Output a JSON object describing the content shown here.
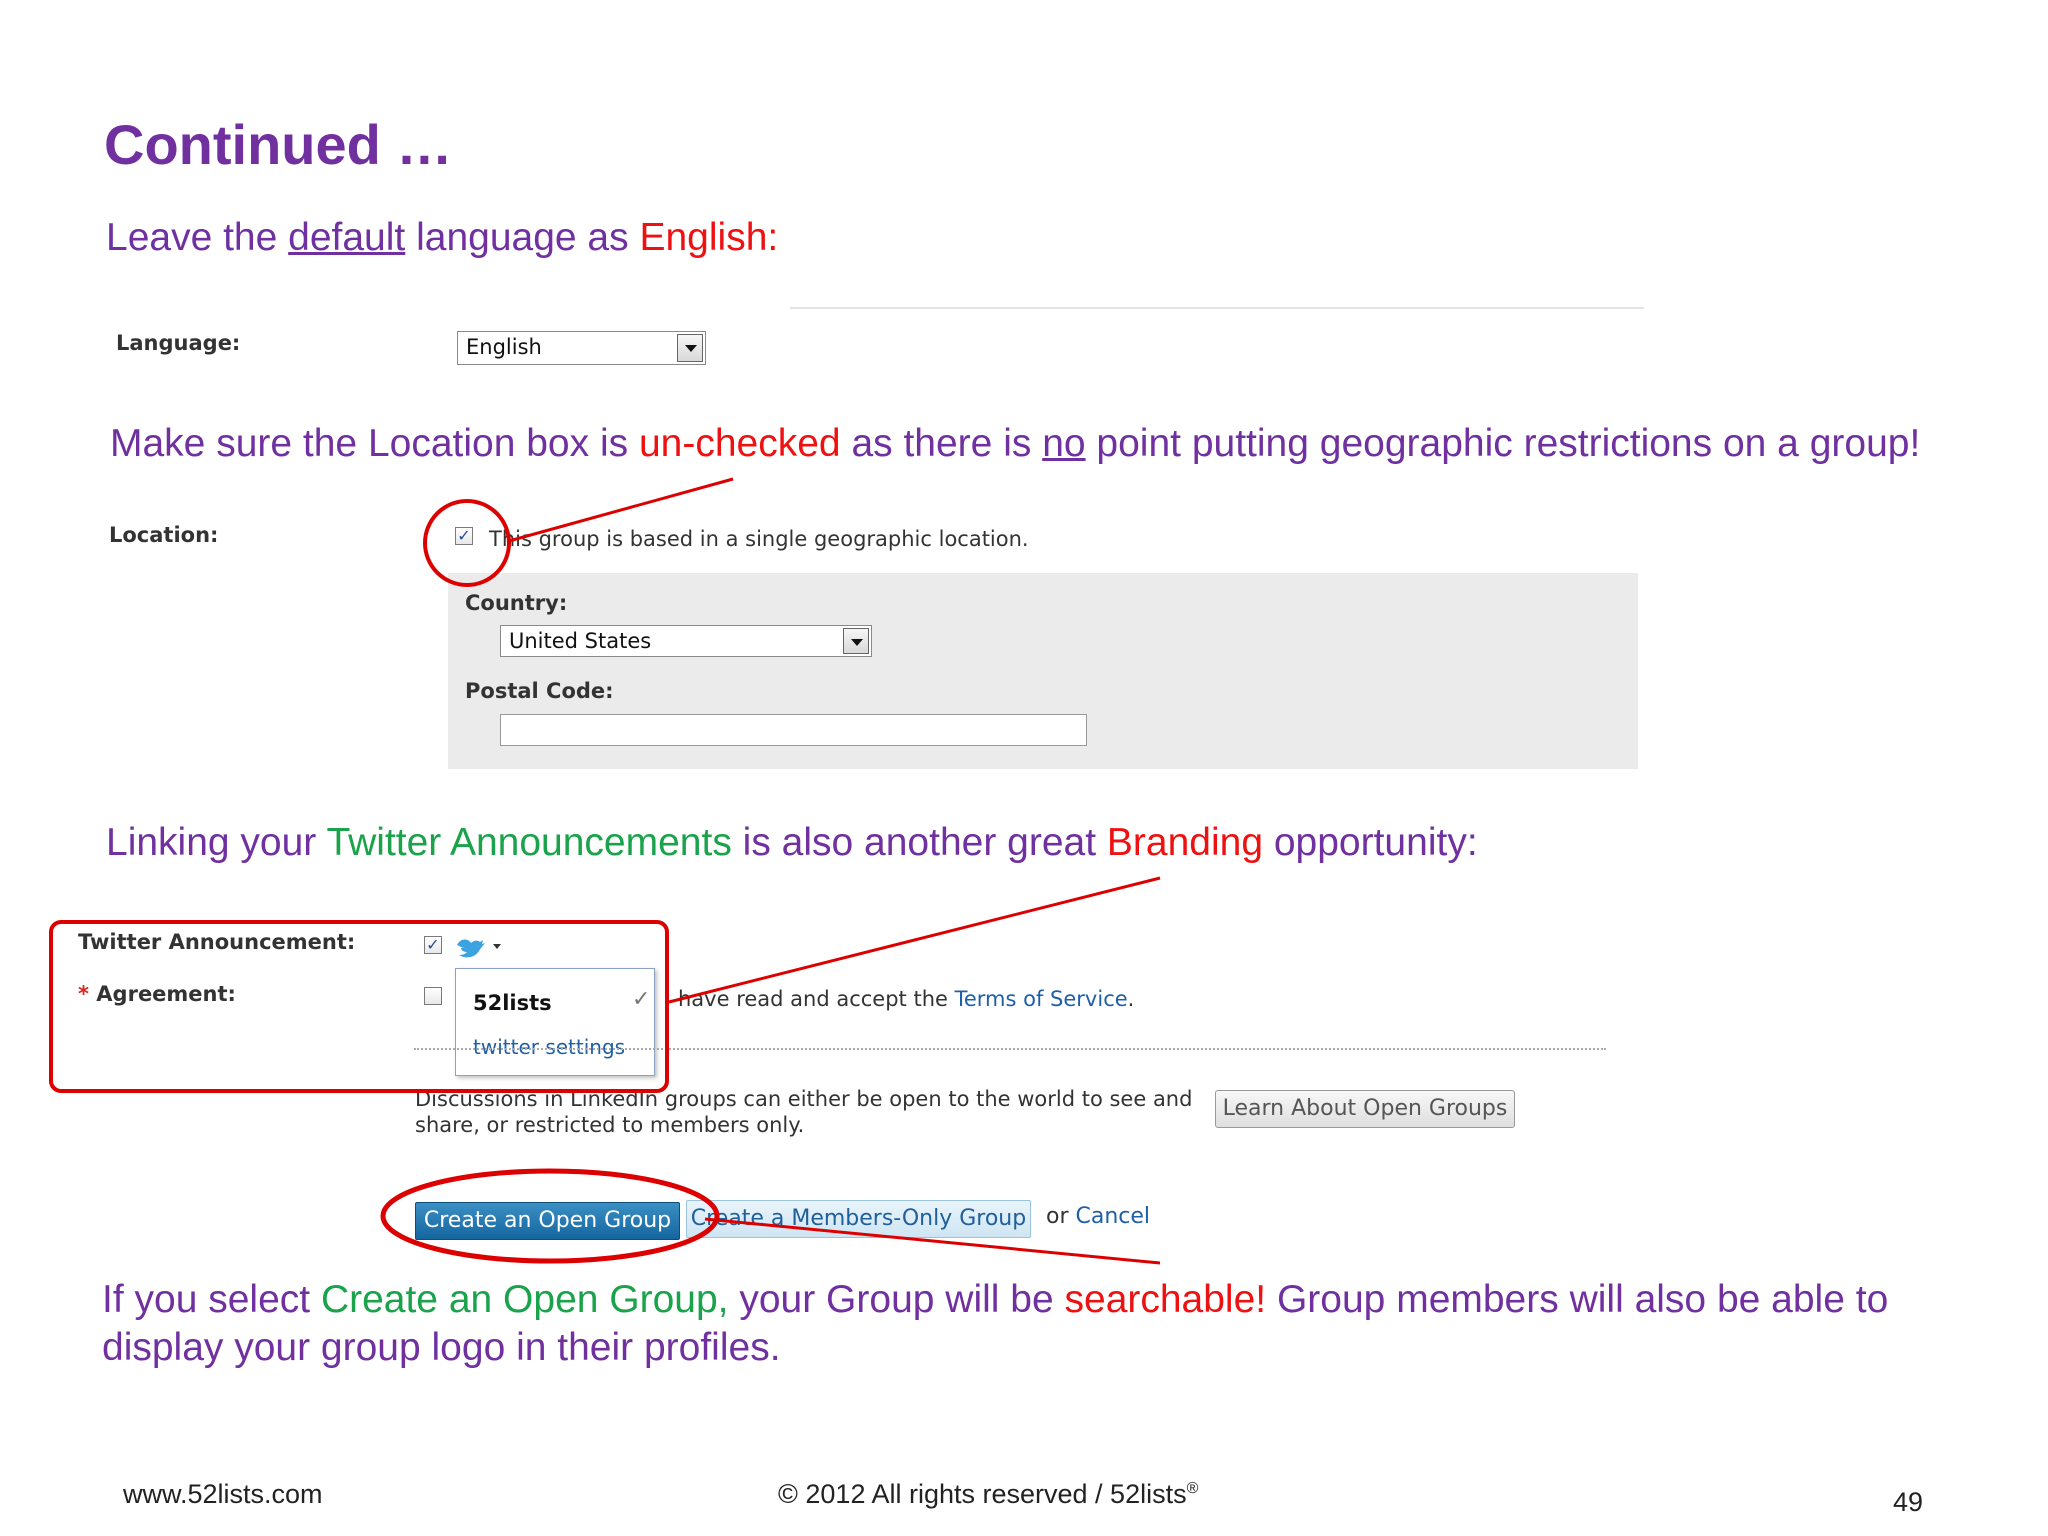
{
  "slide": {
    "title": "Continued …",
    "caption1": {
      "p1": "Leave the ",
      "p2": "default",
      "p3": " language as ",
      "p4": "English:"
    },
    "caption2": {
      "p1": "Make sure the Location box is ",
      "p2": "un-checked",
      "p3": " as there is ",
      "p4": "no",
      "p5": " point putting geographic restrictions on a group!"
    },
    "caption3": {
      "p1": "Linking your ",
      "p2": "Twitter Announcements",
      "p3": " is also another great ",
      "p4": "Branding",
      "p5": " opportunity:"
    },
    "caption4": {
      "p1": "If you select  ",
      "p2": "Create an Open Group,",
      "p3": " your Group will be ",
      "p4": "searchable!",
      "p5": " Group members will also be able to",
      "line2": "display your group logo in their profiles."
    }
  },
  "form": {
    "language_label": "Language:",
    "language_value": "English",
    "location_label": "Location:",
    "location_checked": true,
    "location_text": "This group is based in a single geographic location.",
    "country_label": "Country:",
    "country_value": "United States",
    "postal_label": "Postal Code:",
    "postal_value": "",
    "twitter_label": "Twitter Announcement:",
    "twitter_checked": true,
    "agreement_star": "*",
    "agreement_label": "Agreement:",
    "agreement_checked": false,
    "agreement_text": "have read and accept the ",
    "terms_link": "Terms of Service",
    "terms_period": ".",
    "popup_account": "52lists",
    "popup_check": "✓",
    "popup_settings": "twitter settings",
    "discussion_line1": "Discussions in LinkedIn groups can either be open to the world to see and",
    "discussion_line2": "share, or restricted to members only.",
    "learn_button": "Learn About Open Groups",
    "create_open_button": "Create an Open Group",
    "create_members_button": "Create a Members-Only Group",
    "or_text": "or ",
    "cancel_link": "Cancel"
  },
  "footer": {
    "website": "www.52lists.com",
    "copyright": "© 2012 All rights reserved / 52lists",
    "registered": "®",
    "page_number": "49"
  },
  "colors": {
    "title_purple": "#7030a0",
    "highlight_red": "#ee1111",
    "highlight_green": "#1aa34a",
    "annotation_red": "#dd0000",
    "twitter_blue": "#3aa3e0",
    "linkedin_blue": "#1566a0"
  },
  "icons": {
    "twitter": "twitter-bird-icon",
    "dropdown": "chevron-down-icon"
  }
}
